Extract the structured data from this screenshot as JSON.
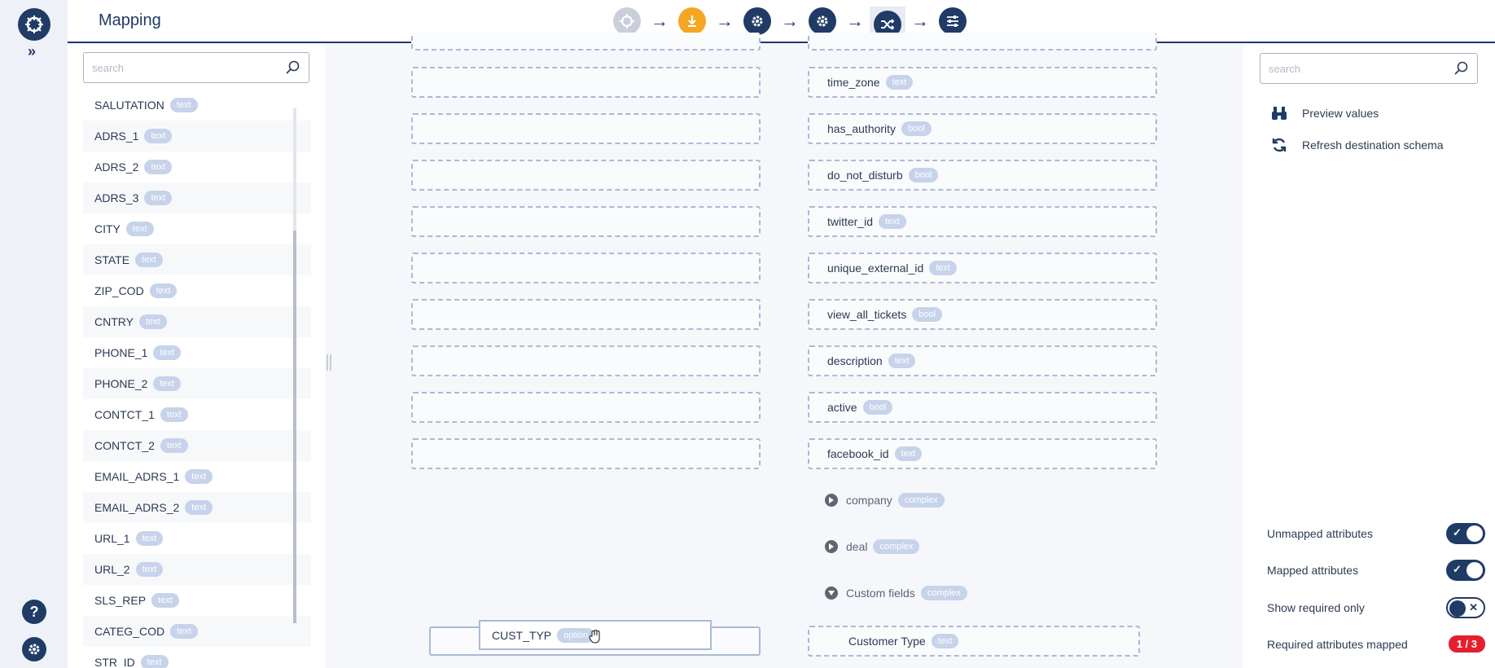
{
  "app": {
    "title": "Mapping"
  },
  "stepper": {
    "steps": [
      {
        "icon": "connector-logo-icon",
        "state": "done"
      },
      {
        "icon": "download-icon",
        "state": "warning"
      },
      {
        "icon": "gear-icon",
        "state": "done"
      },
      {
        "icon": "gear-icon",
        "state": "done"
      },
      {
        "icon": "shuffle-icon",
        "state": "active"
      },
      {
        "icon": "sliders-icon",
        "state": "done"
      }
    ]
  },
  "source": {
    "search_placeholder": "search",
    "items": [
      {
        "label": "SALUTATION",
        "type": "text"
      },
      {
        "label": "ADRS_1",
        "type": "text"
      },
      {
        "label": "ADRS_2",
        "type": "text"
      },
      {
        "label": "ADRS_3",
        "type": "text"
      },
      {
        "label": "CITY",
        "type": "text"
      },
      {
        "label": "STATE",
        "type": "text"
      },
      {
        "label": "ZIP_COD",
        "type": "text"
      },
      {
        "label": "CNTRY",
        "type": "text"
      },
      {
        "label": "PHONE_1",
        "type": "text"
      },
      {
        "label": "PHONE_2",
        "type": "text"
      },
      {
        "label": "CONTCT_1",
        "type": "text"
      },
      {
        "label": "CONTCT_2",
        "type": "text"
      },
      {
        "label": "EMAIL_ADRS_1",
        "type": "text"
      },
      {
        "label": "EMAIL_ADRS_2",
        "type": "text"
      },
      {
        "label": "URL_1",
        "type": "text"
      },
      {
        "label": "URL_2",
        "type": "text"
      },
      {
        "label": "SLS_REP",
        "type": "text"
      },
      {
        "label": "CATEG_COD",
        "type": "text"
      },
      {
        "label": "STR_ID",
        "type": "text"
      }
    ]
  },
  "destination": {
    "fields": [
      {
        "label": "time_zone",
        "type": "text"
      },
      {
        "label": "has_authority",
        "type": "bool"
      },
      {
        "label": "do_not_disturb",
        "type": "bool"
      },
      {
        "label": "twitter_id",
        "type": "text"
      },
      {
        "label": "unique_external_id",
        "type": "text"
      },
      {
        "label": "view_all_tickets",
        "type": "bool"
      },
      {
        "label": "description",
        "type": "text"
      },
      {
        "label": "active",
        "type": "bool"
      },
      {
        "label": "facebook_id",
        "type": "text"
      }
    ],
    "groups": [
      {
        "label": "company",
        "type": "complex",
        "expanded": false
      },
      {
        "label": "deal",
        "type": "complex",
        "expanded": false
      },
      {
        "label": "Custom fields",
        "type": "complex",
        "expanded": true
      }
    ],
    "custom_field": {
      "label": "Customer Type",
      "type": "text"
    }
  },
  "dragging": {
    "label": "CUST_TYP",
    "type": "option"
  },
  "right": {
    "search_placeholder": "search",
    "actions": {
      "preview": "Preview values",
      "refresh": "Refresh destination schema"
    },
    "toggles": {
      "unmapped": {
        "label": "Unmapped attributes",
        "on": true
      },
      "mapped": {
        "label": "Mapped attributes",
        "on": true
      },
      "required": {
        "label": "Show required only",
        "on": false
      }
    },
    "required_mapped": {
      "label": "Required attributes mapped",
      "value": "1 / 3"
    }
  },
  "colors": {
    "primary": "#1f3b66",
    "warning": "#f5a623",
    "danger": "#e5202e",
    "badge": "#c6d3ea"
  }
}
